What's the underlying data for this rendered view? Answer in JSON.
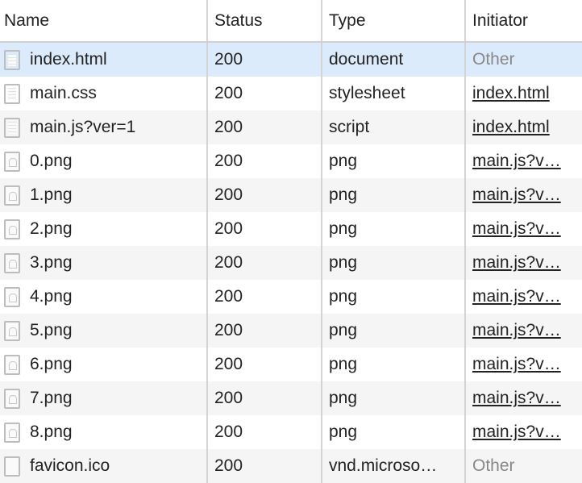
{
  "columns": [
    "Name",
    "Status",
    "Type",
    "Initiator"
  ],
  "rows": [
    {
      "name": "index.html",
      "status": "200",
      "type": "document",
      "initiator": "Other",
      "icon": "doc",
      "link": false
    },
    {
      "name": "main.css",
      "status": "200",
      "type": "stylesheet",
      "initiator": "index.html",
      "icon": "doc",
      "link": true
    },
    {
      "name": "main.js?ver=1",
      "status": "200",
      "type": "script",
      "initiator": "index.html",
      "icon": "doc",
      "link": true
    },
    {
      "name": "0.png",
      "status": "200",
      "type": "png",
      "initiator": "main.js?v…",
      "icon": "img",
      "link": true
    },
    {
      "name": "1.png",
      "status": "200",
      "type": "png",
      "initiator": "main.js?v…",
      "icon": "img",
      "link": true
    },
    {
      "name": "2.png",
      "status": "200",
      "type": "png",
      "initiator": "main.js?v…",
      "icon": "img",
      "link": true
    },
    {
      "name": "3.png",
      "status": "200",
      "type": "png",
      "initiator": "main.js?v…",
      "icon": "img",
      "link": true
    },
    {
      "name": "4.png",
      "status": "200",
      "type": "png",
      "initiator": "main.js?v…",
      "icon": "img",
      "link": true
    },
    {
      "name": "5.png",
      "status": "200",
      "type": "png",
      "initiator": "main.js?v…",
      "icon": "img",
      "link": true
    },
    {
      "name": "6.png",
      "status": "200",
      "type": "png",
      "initiator": "main.js?v…",
      "icon": "img",
      "link": true
    },
    {
      "name": "7.png",
      "status": "200",
      "type": "png",
      "initiator": "main.js?v…",
      "icon": "img",
      "link": true
    },
    {
      "name": "8.png",
      "status": "200",
      "type": "png",
      "initiator": "main.js?v…",
      "icon": "img",
      "link": true
    },
    {
      "name": "favicon.ico",
      "status": "200",
      "type": "vnd.microso…",
      "initiator": "Other",
      "icon": "blank",
      "link": false
    }
  ],
  "selected_row": 0,
  "colors": {
    "selected": "#dcebfb",
    "alt_row": "#f5f5f5"
  }
}
